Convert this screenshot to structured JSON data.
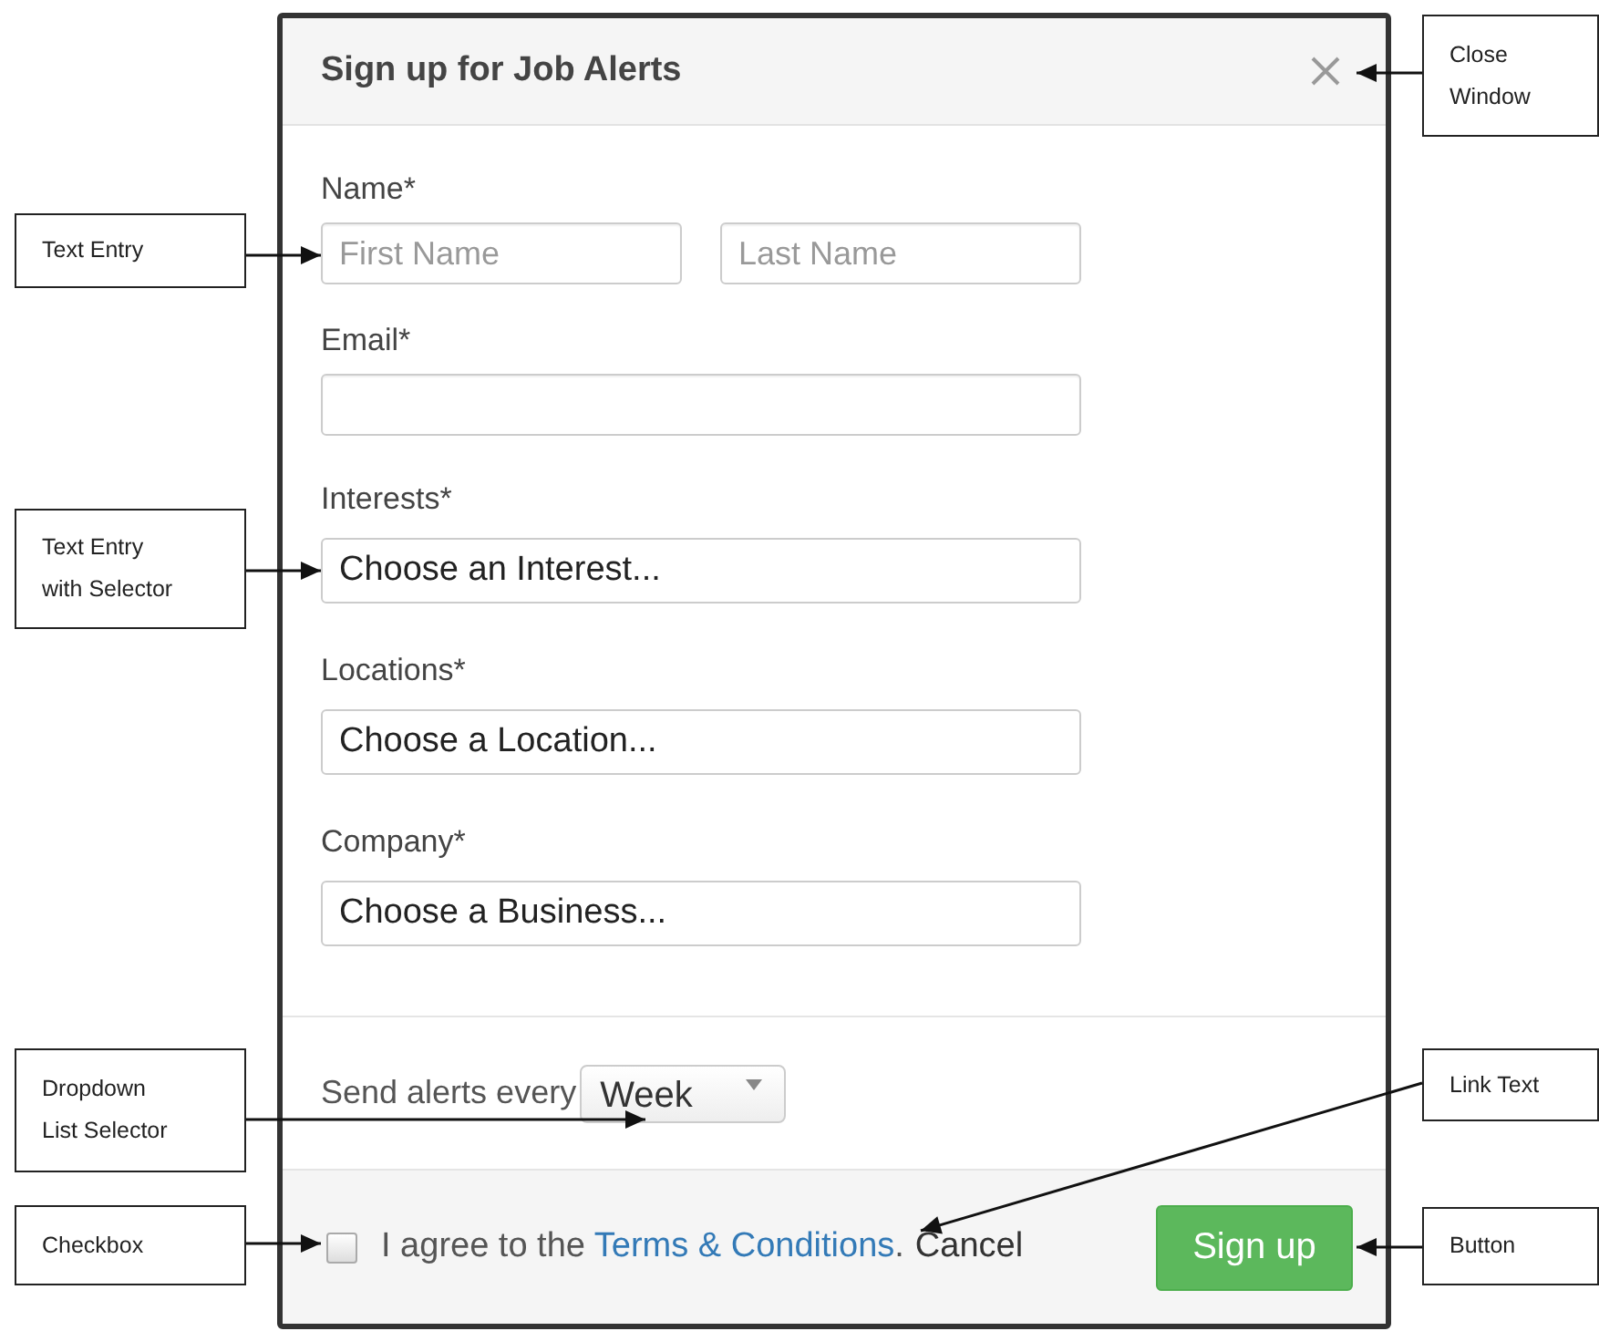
{
  "dialog": {
    "title": "Sign up for Job Alerts",
    "fields": [
      {
        "label": "Name*",
        "kind": "split",
        "inputs": [
          {
            "placeholder": "First Name"
          },
          {
            "placeholder": "Last Name"
          }
        ]
      },
      {
        "label": "Email*",
        "kind": "text"
      },
      {
        "label": "Interests*",
        "kind": "select",
        "value": "Choose an Interest..."
      },
      {
        "label": "Locations*",
        "kind": "select",
        "value": "Choose a Location..."
      },
      {
        "label": "Company*",
        "kind": "select",
        "value": "Choose a Business..."
      }
    ],
    "frequency": {
      "label": "Send alerts every",
      "value": "Week"
    },
    "footer": {
      "checked": false,
      "agree_before": "I agree to the ",
      "link": "Terms & Conditions",
      "agree_after": ".",
      "cancel": "Cancel",
      "submit": "Sign up"
    }
  },
  "callouts": [
    {
      "text": "Close Window"
    },
    {
      "text": "Text Entry"
    },
    {
      "text": "Text Entry with Selector"
    },
    {
      "text": "Dropdown List Selector"
    },
    {
      "text": "Link Text"
    },
    {
      "text": "Checkbox"
    },
    {
      "text": "Button"
    }
  ]
}
